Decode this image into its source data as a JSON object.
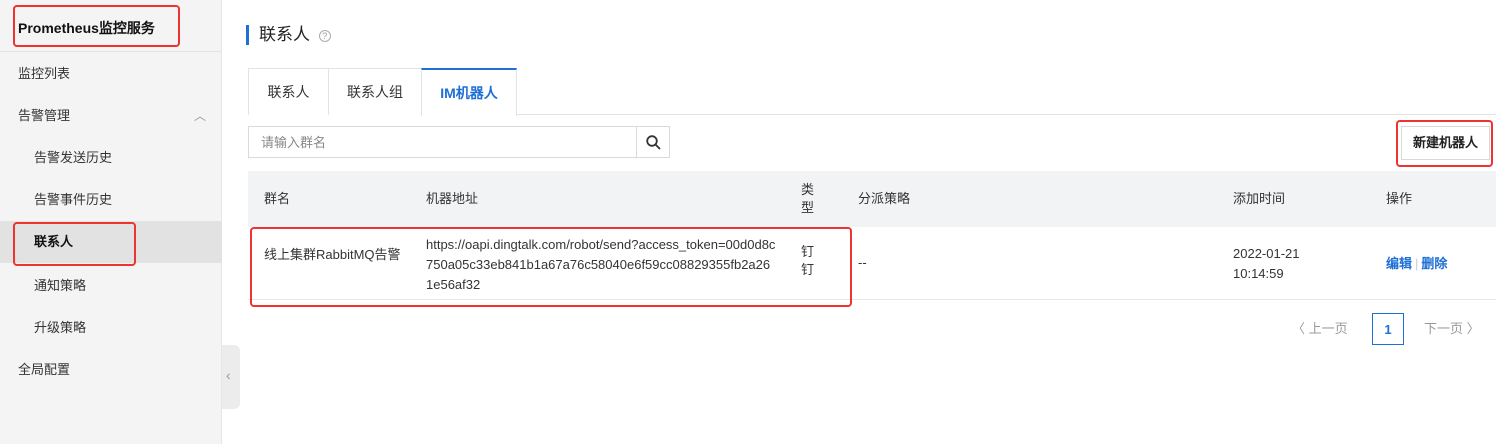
{
  "sidebar": {
    "title": "Prometheus监控服务",
    "items": [
      {
        "label": "监控列表"
      },
      {
        "label": "告警管理",
        "arrow": "︿"
      },
      {
        "label": "告警发送历史"
      },
      {
        "label": "告警事件历史"
      },
      {
        "label": "联系人"
      },
      {
        "label": "通知策略"
      },
      {
        "label": "升级策略"
      },
      {
        "label": "全局配置"
      }
    ],
    "collapse_glyph": "‹"
  },
  "page": {
    "title": "联系人",
    "help": "?"
  },
  "tabs": [
    {
      "label": "联系人"
    },
    {
      "label": "联系人组"
    },
    {
      "label": "IM机器人"
    }
  ],
  "search": {
    "placeholder": "请输入群名",
    "value": ""
  },
  "toolbar": {
    "new_robot_label": "新建机器人"
  },
  "table": {
    "headers": {
      "name": "群名",
      "url": "机器地址",
      "type_line1": "类",
      "type_line2": "型",
      "policy": "分派策略",
      "time": "添加时间",
      "ops": "操作"
    },
    "rows": [
      {
        "name": "线上集群RabbitMQ告警",
        "url": "https://oapi.dingtalk.com/robot/send?access_token=00d0d8c750a05c33eb841b1a67a76c58040e6f59cc08829355fb2a261e56af32",
        "type_line1": "钉",
        "type_line2": "钉",
        "policy": "--",
        "time": "2022-01-21 10:14:59",
        "op_edit": "编辑",
        "op_sep": "|",
        "op_delete": "删除"
      }
    ]
  },
  "pagination": {
    "prev": "〈 上一页",
    "current": "1",
    "next": "下一页 〉"
  },
  "colors": {
    "accent": "#1e6fd6",
    "annotation": "#ee3333",
    "top_accent": "#ff6a00"
  }
}
